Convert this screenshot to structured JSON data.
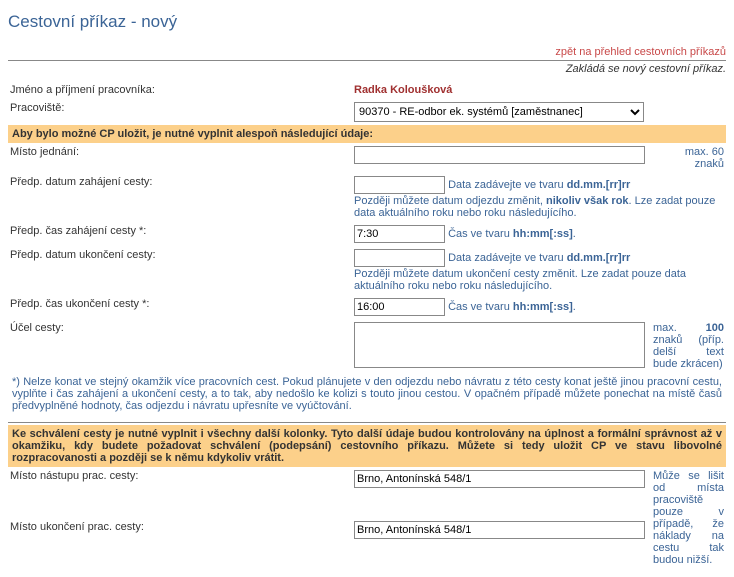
{
  "page": {
    "title": "Cestovní příkaz - nový",
    "back_link": "zpět na přehled cestovních příkazů",
    "subtitle": "Zakládá se nový cestovní příkaz."
  },
  "person": {
    "name_label": "Jméno a příjmení pracovníka:",
    "name_value": "Radka Koloušková",
    "workplace_label": "Pracoviště:",
    "workplace_value": "90370 - RE-odbor ek. systémů [zaměstnanec]"
  },
  "bar1": "Aby bylo možné CP uložit, je nutné vyplnit alespoň následující údaje:",
  "fields": {
    "place_label": "Místo jednání:",
    "place_value": "",
    "place_hint": "max. 60 znaků",
    "start_date_label": "Předp. datum zahájení cesty:",
    "start_date_value": "",
    "start_date_hint1": "Data zadávejte ve tvaru ",
    "start_date_hint1b": "dd.mm.[rr]rr",
    "start_date_hint2": "Později můžete datum odjezdu změnit, ",
    "start_date_hint2b": "nikoliv však rok",
    "start_date_hint2c": ". Lze zadat pouze data aktuálního roku nebo roku následujícího.",
    "start_time_label": "Předp. čas zahájení cesty *:",
    "start_time_value": "7:30",
    "start_time_hint1": "Čas ve tvaru ",
    "start_time_hint1b": "hh:mm[:ss]",
    "end_date_label": "Předp. datum ukončení cesty:",
    "end_date_value": "",
    "end_date_hint1": "Data zadávejte ve tvaru ",
    "end_date_hint1b": "dd.mm.[rr]rr",
    "end_date_hint2": "Později můžete datum ukončení cesty změnit. Lze zadat pouze data aktuálního roku nebo roku následujícího.",
    "end_time_label": "Předp. čas ukončení cesty *:",
    "end_time_value": "16:00",
    "end_time_hint1": "Čas ve tvaru ",
    "end_time_hint1b": "hh:mm[:ss]",
    "purpose_label": "Účel cesty:",
    "purpose_value": "",
    "purpose_hint1": "max. ",
    "purpose_hint1b": "100",
    "purpose_hint1c": " znaků (příp. delší text bude zkrácen)"
  },
  "footnote": "*) Nelze konat ve stejný okamžik více pracovních cest. Pokud plánujete v den odjezdu nebo návratu z této cesty konat ještě jinou pracovní cestu, vyplňte i čas zahájení a ukončení cesty, a to tak, aby nedošlo ke kolizi s touto jinou cestou. V opačném případě můžete ponechat na místě časů předvyplněné hodnoty, čas odjezdu i návratu upřesníte ve vyúčtování.",
  "bar2": "Ke schválení cesty je nutné vyplnit i všechny další kolonky. Tyto další údaje budou kontrolovány na úplnost a formální správnost až v okamžiku, kdy budete požadovat schválení (podepsání) cestovního příkazu. Můžete si tedy uložit CP ve stavu libovolné rozpracovanosti a později se k němu kdykoliv vrátit.",
  "places": {
    "start_label": "Místo nástupu prac. cesty:",
    "start_value": "Brno, Antonínská 548/1",
    "end_label": "Místo ukončení prac. cesty:",
    "end_value": "Brno, Antonínská 548/1",
    "hint": "Může se lišit od místa pracoviště pouze v případě, že náklady na cestu tak budou nižší."
  }
}
